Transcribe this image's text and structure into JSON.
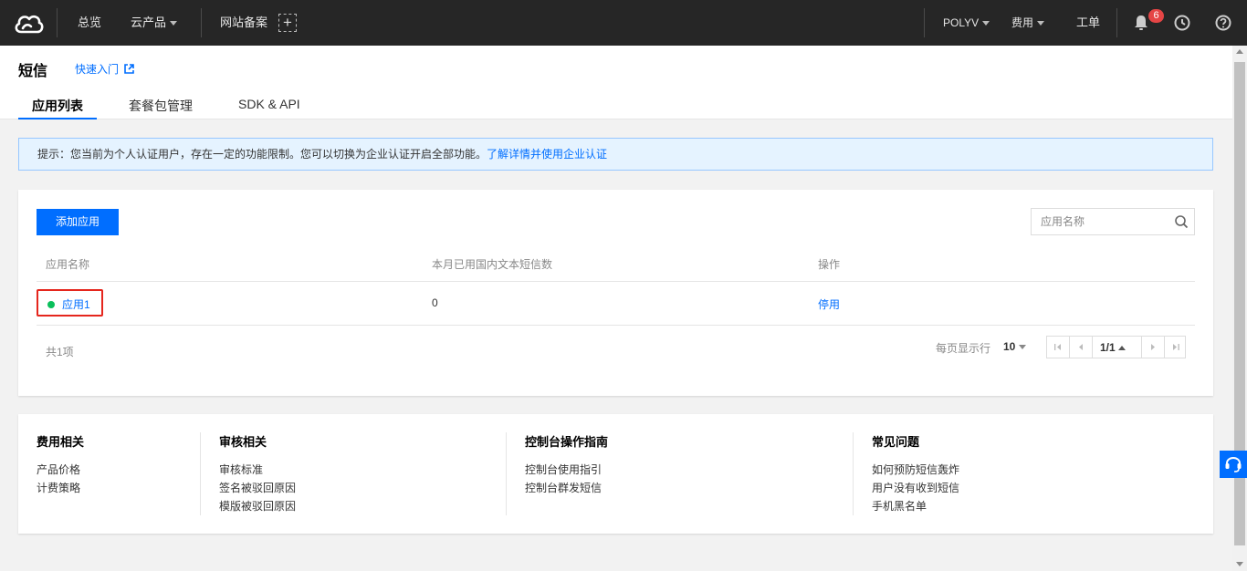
{
  "topnav": {
    "logo_icon": "cloud-logo-icon",
    "overview": "总览",
    "products": "云产品",
    "icp": "网站备案",
    "add": "+",
    "account": "POLYV",
    "billing": "费用",
    "ticket": "工单",
    "notification_count": "6",
    "icons": [
      "bell-icon",
      "clock-icon",
      "help-icon"
    ]
  },
  "header": {
    "title": "短信",
    "quick_start": "快速入门",
    "tabs": [
      {
        "label": "应用列表",
        "active": true
      },
      {
        "label": "套餐包管理",
        "active": false
      },
      {
        "label": "SDK & API",
        "active": false
      }
    ]
  },
  "notice": {
    "text": "提示：您当前为个人认证用户，存在一定的功能限制。您可以切换为企业认证开启全部功能。",
    "link": "了解详情并使用企业认证"
  },
  "main": {
    "add_button": "添加应用",
    "search_placeholder": "应用名称",
    "columns": [
      "应用名称",
      "本月已用国内文本短信数",
      "操作"
    ],
    "rows": [
      {
        "name": "应用1",
        "status_color": "#0abf5b",
        "count": "0",
        "action": "停用"
      }
    ],
    "total": "共1项",
    "per_page_label": "每页显示行",
    "per_page_value": "10",
    "page": "1/1"
  },
  "footer": {
    "sections": [
      {
        "title": "费用相关",
        "links": [
          "产品价格",
          "计费策略"
        ]
      },
      {
        "title": "审核相关",
        "links": [
          "审核标准",
          "签名被驳回原因",
          "模版被驳回原因"
        ]
      },
      {
        "title": "控制台操作指南",
        "links": [
          "控制台使用指引",
          "控制台群发短信"
        ]
      },
      {
        "title": "常见问题",
        "links": [
          "如何预防短信轰炸",
          "用户没有收到短信",
          "手机黑名单"
        ]
      }
    ]
  },
  "colors": {
    "accent": "#006eff",
    "topbar": "#262626",
    "highlight_border": "#e5261d",
    "badge": "#e54545"
  }
}
